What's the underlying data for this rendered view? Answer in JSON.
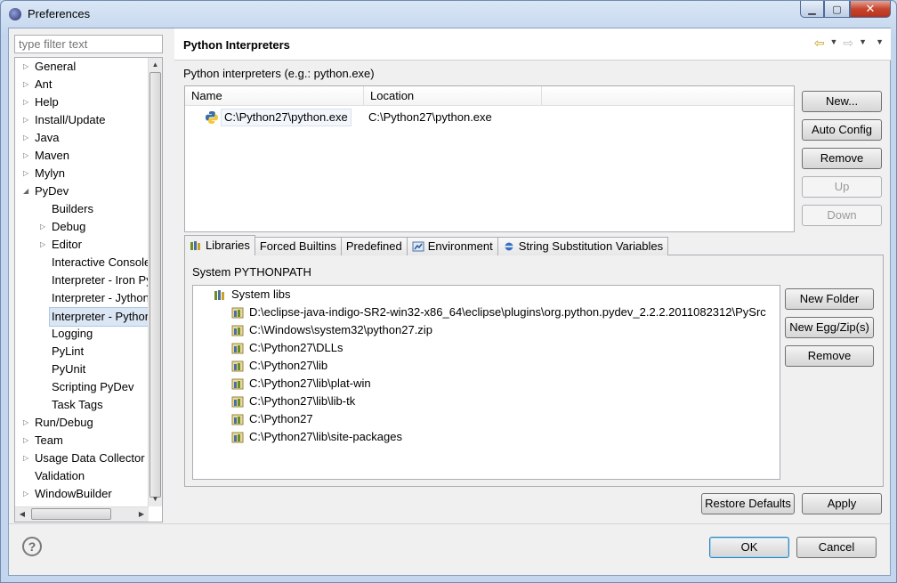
{
  "window": {
    "title": "Preferences"
  },
  "filter": {
    "placeholder": "type filter text"
  },
  "tree": [
    {
      "label": "General",
      "expander": "closed",
      "indent": 0
    },
    {
      "label": "Ant",
      "expander": "closed",
      "indent": 0
    },
    {
      "label": "Help",
      "expander": "closed",
      "indent": 0
    },
    {
      "label": "Install/Update",
      "expander": "closed",
      "indent": 0
    },
    {
      "label": "Java",
      "expander": "closed",
      "indent": 0
    },
    {
      "label": "Maven",
      "expander": "closed",
      "indent": 0
    },
    {
      "label": "Mylyn",
      "expander": "closed",
      "indent": 0
    },
    {
      "label": "PyDev",
      "expander": "open",
      "indent": 0
    },
    {
      "label": "Builders",
      "expander": "none",
      "indent": 1
    },
    {
      "label": "Debug",
      "expander": "closed",
      "indent": 1
    },
    {
      "label": "Editor",
      "expander": "closed",
      "indent": 1
    },
    {
      "label": "Interactive Console",
      "expander": "none",
      "indent": 1
    },
    {
      "label": "Interpreter - Iron Python",
      "expander": "none",
      "indent": 1
    },
    {
      "label": "Interpreter - Jython",
      "expander": "none",
      "indent": 1
    },
    {
      "label": "Interpreter - Python",
      "expander": "none",
      "indent": 1,
      "selected": true
    },
    {
      "label": "Logging",
      "expander": "none",
      "indent": 1
    },
    {
      "label": "PyLint",
      "expander": "none",
      "indent": 1
    },
    {
      "label": "PyUnit",
      "expander": "none",
      "indent": 1
    },
    {
      "label": "Scripting PyDev",
      "expander": "none",
      "indent": 1
    },
    {
      "label": "Task Tags",
      "expander": "none",
      "indent": 1
    },
    {
      "label": "Run/Debug",
      "expander": "closed",
      "indent": 0
    },
    {
      "label": "Team",
      "expander": "closed",
      "indent": 0
    },
    {
      "label": "Usage Data Collector",
      "expander": "closed",
      "indent": 0
    },
    {
      "label": "Validation",
      "expander": "none",
      "indent": 0
    },
    {
      "label": "WindowBuilder",
      "expander": "closed",
      "indent": 0
    }
  ],
  "page": {
    "title": "Python Interpreters",
    "interpreters_label": "Python interpreters (e.g.: python.exe)",
    "columns": {
      "name": "Name",
      "location": "Location"
    },
    "interpreters": [
      {
        "name": "C:\\Python27\\python.exe",
        "location": "C:\\Python27\\python.exe"
      }
    ],
    "buttons": {
      "new": "New...",
      "auto_config": "Auto Config",
      "remove": "Remove",
      "up": "Up",
      "down": "Down"
    },
    "tabs": {
      "libraries": "Libraries",
      "forced_builtins": "Forced Builtins",
      "predefined": "Predefined",
      "environment": "Environment",
      "string_subst": "String Substitution Variables"
    },
    "system_pythonpath_label": "System PYTHONPATH",
    "system_libs_label": "System libs",
    "libs": [
      "D:\\eclipse-java-indigo-SR2-win32-x86_64\\eclipse\\plugins\\org.python.pydev_2.2.2.2011082312\\PySrc",
      "C:\\Windows\\system32\\python27.zip",
      "C:\\Python27\\DLLs",
      "C:\\Python27\\lib",
      "C:\\Python27\\lib\\plat-win",
      "C:\\Python27\\lib\\lib-tk",
      "C:\\Python27",
      "C:\\Python27\\lib\\site-packages"
    ],
    "lib_buttons": {
      "new_folder": "New Folder",
      "new_egg": "New Egg/Zip(s)",
      "remove": "Remove"
    },
    "restore_defaults": "Restore Defaults",
    "apply": "Apply"
  },
  "footer": {
    "ok": "OK",
    "cancel": "Cancel",
    "help": "?"
  }
}
